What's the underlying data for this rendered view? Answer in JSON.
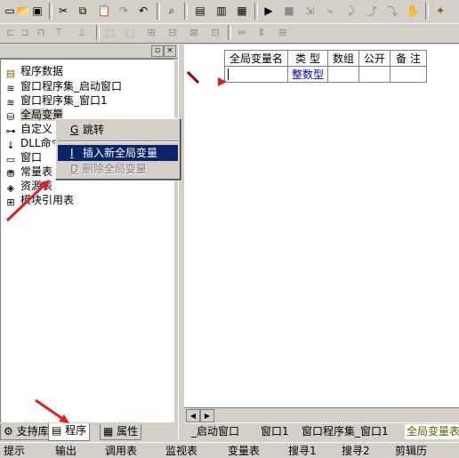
{
  "toolbar": {
    "icons": [
      "new-icon",
      "open-icon",
      "save-icon",
      "cut-icon",
      "copy-icon",
      "paste-icon",
      "redo-icon",
      "undo-icon",
      "find-icon",
      "window-layout-1-icon",
      "window-layout-2-icon",
      "window-layout-3-icon",
      "run-icon",
      "stop-icon",
      "step-icon",
      "step-into-icon",
      "step-over-icon",
      "step-out-icon",
      "hand-icon",
      "help-icon"
    ]
  },
  "left_panel": {
    "tree": [
      {
        "label": "程序数据",
        "icon": "folder-icon"
      },
      {
        "label": "窗口程序集_启动窗口",
        "icon": "module-icon"
      },
      {
        "label": "窗口程序集_窗口1",
        "icon": "module-icon"
      },
      {
        "label": "全局变量",
        "icon": "database-icon"
      },
      {
        "label": "自定义",
        "icon": "type-icon"
      },
      {
        "label": "DLL命令",
        "icon": "dll-icon"
      },
      {
        "label": "窗口",
        "icon": "window-icon"
      },
      {
        "label": "常量表",
        "icon": "constant-icon"
      },
      {
        "label": "资源表",
        "icon": "resource-icon"
      },
      {
        "label": "模块引用表",
        "icon": "module-ref-icon"
      }
    ],
    "tabs": [
      "支持库",
      "程序",
      "属性"
    ]
  },
  "context_menu": {
    "items": [
      {
        "accel": "G",
        "label": "跳转"
      },
      {
        "accel": "I",
        "label": "插入新全局变量"
      },
      {
        "accel": "D",
        "label": "删除全局变量"
      }
    ]
  },
  "grid": {
    "headers": [
      "全局变量名",
      "类 型",
      "数组",
      "公开",
      "备 注"
    ],
    "row": {
      "name": "",
      "type": "整数型",
      "array": "",
      "public": "",
      "note": ""
    }
  },
  "editor_tabs": [
    "_启动窗口",
    "窗口1",
    "窗口程序集_窗口1",
    "全局变量表"
  ],
  "status_tabs": [
    "提示",
    "输出",
    "调用表",
    "监视表",
    "变量表",
    "搜寻1",
    "搜寻2",
    "剪辑历"
  ]
}
